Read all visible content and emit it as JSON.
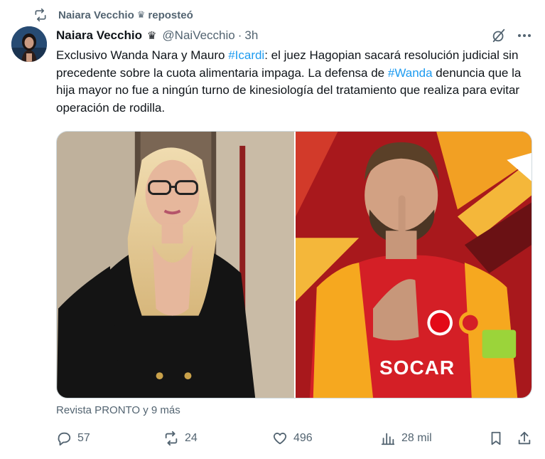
{
  "repost": {
    "user": "Naiara Vecchio",
    "label": "reposteó",
    "badge_glyph": "♛"
  },
  "author": {
    "name": "Naiara Vecchio",
    "badge_glyph": "♛",
    "handle": "@NaiVecchio",
    "separator": "·",
    "time": "3h"
  },
  "tweet": {
    "segments": {
      "t1": "Exclusivo Wanda Nara y Mauro ",
      "h1": "#Icardi",
      "t2": ": el juez Hagopian sacará resolución judicial sin precedente sobre la cuota alimentaria impaga. La defensa de ",
      "h2": "#Wanda",
      "t3": " denuncia que la hija mayor no fue a ningún turno de kinesiología del tratamiento que realiza para evitar operación de rodilla."
    }
  },
  "media": {
    "jersey_brand": "SOCAR"
  },
  "attribution": "Revista PRONTO y 9 más",
  "actions": {
    "replies": "57",
    "reposts": "24",
    "likes": "496",
    "views": "28 mil"
  },
  "colors": {
    "link": "#1d9bf0",
    "muted": "#536471",
    "text": "#0f1419",
    "border": "#cfd9de"
  },
  "icons": [
    "repost-icon",
    "grok-icon",
    "more-icon",
    "reply-icon",
    "like-icon",
    "views-icon",
    "bookmark-icon",
    "share-icon"
  ]
}
